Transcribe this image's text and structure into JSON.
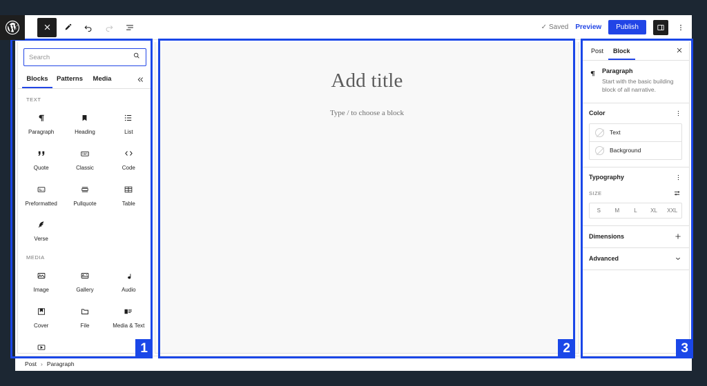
{
  "app": {
    "logo_icon": "wordpress-logo-icon"
  },
  "header": {
    "close_label": "✕",
    "tools": [
      {
        "name": "close-editor-button",
        "icon": "close-icon",
        "label": "✕"
      },
      {
        "name": "edit-tool-button",
        "icon": "pencil-icon",
        "label": ""
      },
      {
        "name": "undo-button",
        "icon": "undo-icon",
        "label": ""
      },
      {
        "name": "redo-button",
        "icon": "redo-icon",
        "label": ""
      },
      {
        "name": "list-view-button",
        "icon": "list-view-icon",
        "label": ""
      }
    ],
    "saved_label": "Saved",
    "saved_check": "✓",
    "preview_label": "Preview",
    "publish_label": "Publish",
    "sidebar_toggle_icon": "sidebar-panel-icon",
    "options_icon": "vertical-ellipsis-icon"
  },
  "inserter": {
    "search": {
      "placeholder": "Search",
      "value": "",
      "icon": "search-icon"
    },
    "tabs": [
      {
        "label": "Blocks",
        "active": true
      },
      {
        "label": "Patterns",
        "active": false
      },
      {
        "label": "Media",
        "active": false
      }
    ],
    "tabs_end_icon": "close-inserter-icon",
    "categories": [
      {
        "label": "TEXT",
        "blocks": [
          {
            "label": "Paragraph",
            "icon": "paragraph-icon"
          },
          {
            "label": "Heading",
            "icon": "heading-icon"
          },
          {
            "label": "List",
            "icon": "list-icon"
          },
          {
            "label": "Quote",
            "icon": "quote-icon"
          },
          {
            "label": "Classic",
            "icon": "classic-icon"
          },
          {
            "label": "Code",
            "icon": "code-icon"
          },
          {
            "label": "Preformatted",
            "icon": "preformatted-icon"
          },
          {
            "label": "Pullquote",
            "icon": "pullquote-icon"
          },
          {
            "label": "Table",
            "icon": "table-icon"
          },
          {
            "label": "Verse",
            "icon": "verse-icon"
          }
        ]
      },
      {
        "label": "MEDIA",
        "blocks": [
          {
            "label": "Image",
            "icon": "image-icon"
          },
          {
            "label": "Gallery",
            "icon": "gallery-icon"
          },
          {
            "label": "Audio",
            "icon": "audio-icon"
          },
          {
            "label": "Cover",
            "icon": "cover-icon"
          },
          {
            "label": "File",
            "icon": "file-icon"
          },
          {
            "label": "Media & Text",
            "icon": "media-text-icon"
          },
          {
            "label": "",
            "icon": "video-icon"
          }
        ]
      }
    ]
  },
  "canvas": {
    "title_placeholder": "Add title",
    "body_placeholder": "Type / to choose a block"
  },
  "settings": {
    "tabs": [
      {
        "label": "Post",
        "active": false
      },
      {
        "label": "Block",
        "active": true
      }
    ],
    "close_label": "✕",
    "block": {
      "icon": "paragraph-icon",
      "name": "Paragraph",
      "description": "Start with the basic building block of all narrative."
    },
    "color": {
      "title": "Color",
      "menu_icon": "vertical-ellipsis-icon",
      "rows": [
        {
          "label": "Text",
          "swatch": "none"
        },
        {
          "label": "Background",
          "swatch": "none"
        }
      ]
    },
    "typography": {
      "title": "Typography",
      "menu_icon": "vertical-ellipsis-icon",
      "size_label": "SIZE",
      "size_tools_icon": "sliders-icon",
      "sizes": [
        "S",
        "M",
        "L",
        "XL",
        "XXL"
      ]
    },
    "dimensions": {
      "title": "Dimensions",
      "icon": "plus-icon"
    },
    "advanced": {
      "title": "Advanced",
      "icon": "chevron-down-icon"
    }
  },
  "footer": {
    "breadcrumb": [
      {
        "label": "Post"
      },
      {
        "label": "Paragraph"
      }
    ],
    "separator": "›"
  },
  "annotations": [
    {
      "id": "1",
      "region": "block-inserter-panel"
    },
    {
      "id": "2",
      "region": "editor-canvas"
    },
    {
      "id": "3",
      "region": "block-settings-sidebar"
    }
  ],
  "colors": {
    "accent": "#2145e6",
    "annotation": "#1a47e8",
    "app_background": "#1c2733",
    "canvas": "#f8f8f8"
  }
}
